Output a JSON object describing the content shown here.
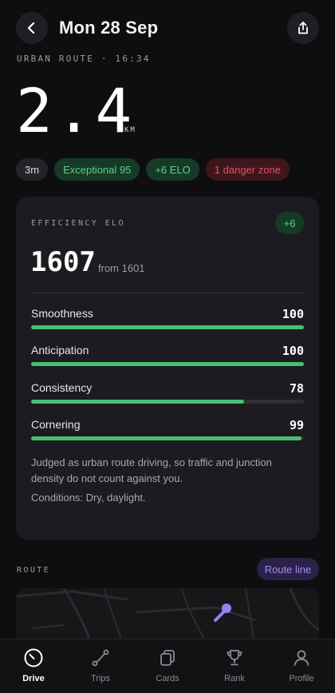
{
  "header": {
    "title": "Mon 28 Sep"
  },
  "trip": {
    "meta": "URBAN ROUTE · 16:34",
    "distance": "2.4",
    "distance_unit": "KM"
  },
  "chips": [
    {
      "label": "3m",
      "tone": "neutral"
    },
    {
      "label": "Exceptional 95",
      "tone": "green"
    },
    {
      "label": "+6 ELO",
      "tone": "green"
    },
    {
      "label": "1 danger zone",
      "tone": "red"
    }
  ],
  "efficiency": {
    "label": "EFFICIENCY ELO",
    "delta": "+6",
    "value": "1607",
    "from_text": "from 1601",
    "metrics": [
      {
        "name": "Smoothness",
        "score": "100",
        "fraction": 1.0
      },
      {
        "name": "Anticipation",
        "score": "100",
        "fraction": 1.0
      },
      {
        "name": "Consistency",
        "score": "78",
        "fraction": 0.78
      },
      {
        "name": "Cornering",
        "score": "99",
        "fraction": 0.99
      }
    ],
    "note": "Judged as urban route driving, so traffic and junction density do not count against you.",
    "conditions": "Conditions: Dry, daylight."
  },
  "route": {
    "label": "ROUTE",
    "button_label": "Route line"
  },
  "tabs": [
    {
      "label": "Drive",
      "icon": "gauge-icon",
      "active": true
    },
    {
      "label": "Trips",
      "icon": "route-icon",
      "active": false
    },
    {
      "label": "Cards",
      "icon": "cards-icon",
      "active": false
    },
    {
      "label": "Rank",
      "icon": "trophy-icon",
      "active": false
    },
    {
      "label": "Profile",
      "icon": "person-icon",
      "active": false
    }
  ],
  "colors": {
    "background": "#0e0e10",
    "card": "#1c1c20",
    "accent_green": "#45c06f",
    "danger_red": "#e2545f",
    "route_purple": "#a58cf0"
  }
}
